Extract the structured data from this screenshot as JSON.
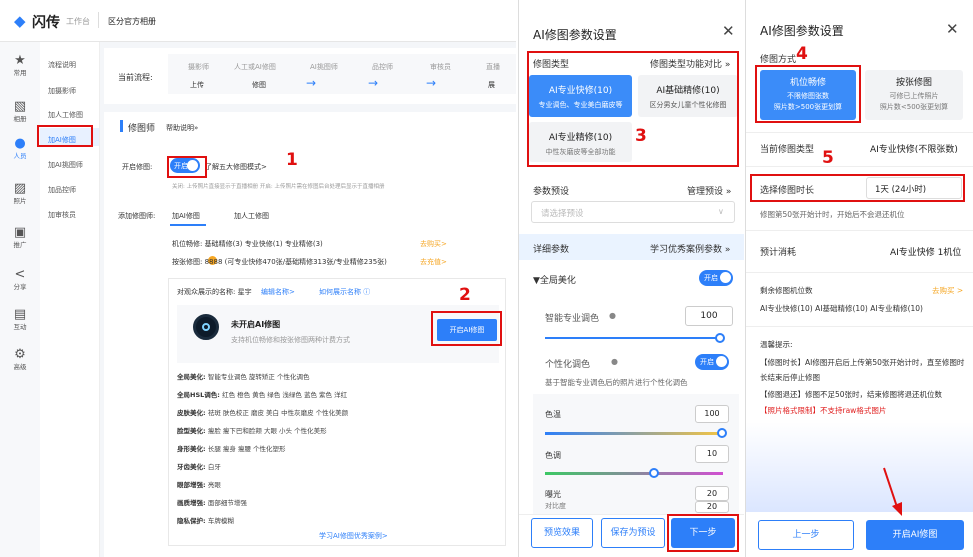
{
  "left": {
    "brand": "闪传",
    "workbench": "工作台",
    "album": "区分官方相册",
    "iconbar": [
      {
        "icon": "star-icon",
        "glyph": "★",
        "label": "常用"
      },
      {
        "icon": "image-icon",
        "glyph": "▧",
        "label": "相册"
      },
      {
        "icon": "person-icon",
        "glyph": "●",
        "label": "人员"
      },
      {
        "icon": "photo-icon",
        "glyph": "▨",
        "label": "照片"
      },
      {
        "icon": "promote-icon",
        "glyph": "▣",
        "label": "推广"
      },
      {
        "icon": "share-icon",
        "glyph": "<",
        "label": "分享"
      },
      {
        "icon": "interact-icon",
        "glyph": "▤",
        "label": "互动"
      },
      {
        "icon": "gear-icon",
        "glyph": "⚙",
        "label": "高级"
      }
    ],
    "subnav": [
      "流程说明",
      "加摄影师",
      "加人工修图",
      "加AI修图",
      "加AI挑图师",
      "加品控师",
      "加审核员"
    ],
    "process": {
      "label": "当前流程:",
      "steps": [
        {
          "role": "摄影师",
          "action": "上传"
        },
        {
          "role": "人工或AI修图",
          "action": "修图"
        },
        {
          "role": "AI挑图师",
          "action": "→"
        },
        {
          "role": "品控师",
          "action": "→"
        },
        {
          "role": "审核员",
          "action": "→"
        },
        {
          "role": "直播",
          "action": "展"
        }
      ]
    },
    "retoucher_title": "修图师",
    "help": "帮助说明»",
    "enable_label": "开启修图:",
    "toggle": "开启",
    "five_modes": "了解五大修图模式>",
    "enable_hint": "关闭: 上传照片直接显示于直播相册    开启: 上传照片需在修图后台处理后显示于直播相册",
    "add_label": "添加修图师:",
    "add_tabs": [
      "加AI修图",
      "加人工修图"
    ],
    "quota1": "机位畅修: 基础精修(3)  专业快修(1)  专业精修(3)",
    "buy": "去购买>",
    "quota2": "按张修图:  8888 (可专业快修470张/基础精修313张/专业精修235张)",
    "recharge": "去充值>",
    "display_name": "对观众展示的名称: 星宇",
    "edit_name": "编辑名称>",
    "how_name": "如何展示名称 ⓘ",
    "card_title": "未开启AI修图",
    "card_sub": "支持机位畅修和按张修图两种计费方式",
    "card_btn": "开启AI修图",
    "features": [
      {
        "k": "全局美化:",
        "v": "智能专业调色   旋转矫正   个性化调色"
      },
      {
        "k": "全局HSL调色:",
        "v": "红色   橙色   黄色   绿色   浅绿色   蓝色   紫色   洋红"
      },
      {
        "k": "皮肤美化:",
        "v": "祛斑   肤色校正   磨皮   美白   中性灰磨皮   个性化美颜"
      },
      {
        "k": "脸型美化:",
        "v": "瘦脸   瘦下巴和脸颊   大眼   小头   个性化美形"
      },
      {
        "k": "身形美化:",
        "v": "长腿   瘦身   瘦腰   个性化塑形"
      },
      {
        "k": "牙齿美化:",
        "v": "白牙"
      },
      {
        "k": "眼部增强:",
        "v": "亮眼"
      },
      {
        "k": "画质增强:",
        "v": "面部细节增强"
      },
      {
        "k": "隐私保护:",
        "v": "车牌模糊"
      }
    ],
    "learn": "学习AI修图优秀案例>"
  },
  "p2": {
    "title": "AI修图参数设置",
    "type_label": "修图类型",
    "type_compare": "修图类型功能对比 »",
    "types": [
      {
        "name": "AI专业快修(10)",
        "desc": "专业调色、专业美白磨皮等"
      },
      {
        "name": "AI基础精修(10)",
        "desc": "区分男女儿童个性化修图"
      },
      {
        "name": "AI专业精修(10)",
        "desc": "中性灰磨皮等全部功能"
      }
    ],
    "preset_label": "参数预设",
    "preset_manage": "管理预设 »",
    "preset_placeholder": "请选择预设",
    "detail_label": "详细参数",
    "detail_link": "学习优秀案例参数 »",
    "global": "▼全局美化",
    "toggle": "开启",
    "smart": "智能专业调色",
    "smart_val": "100",
    "personal": "个性化调色",
    "personal_sub": "基于智能专业调色后的照片进行个性化调色",
    "temp": "色温",
    "temp_val": "100",
    "tint": "色调",
    "tint_val": "10",
    "exposure": "曝光",
    "exposure_val": "20",
    "contrast": "对比度",
    "btn_preview": "预览效果",
    "btn_save": "保存为预设",
    "btn_next": "下一步"
  },
  "p3": {
    "title": "AI修图参数设置",
    "mode_label": "修图方式",
    "modes": [
      {
        "name": "机位畅修",
        "d1": "不限修图张数",
        "d2": "照片数>500张更划算"
      },
      {
        "name": "按张修图",
        "d1": "可修已上传照片",
        "d2": "照片数<500张更划算"
      }
    ],
    "cur_type_label": "当前修图类型",
    "cur_type": "AI专业快修(不限张数)",
    "dur_label": "选择修图时长",
    "dur_val": "1天 (24小时)",
    "dur_hint": "修图第50张开始计时，开始后不会退还机位",
    "cost_label": "预计消耗",
    "cost_val": "AI专业快修 1机位",
    "remain_label": "剩余修图机位数",
    "remain_buy": "去购买 >",
    "remain_val": "AI专业快修(10)  AI基础精修(10)  AI专业精修(10)",
    "tips_title": "温馨提示:",
    "tip1": "【修图时长】AI修图开启后上传第50张开始计时，直至修图时长结束后停止修图",
    "tip2": "【修图退还】修图不足50张时，结束修图将退还机位数",
    "tip3": "【照片格式限制】不支持raw格式图片",
    "btn_prev": "上一步",
    "btn_start": "开启AI修图"
  },
  "annotations": [
    "1",
    "2",
    "3",
    "4",
    "5"
  ]
}
